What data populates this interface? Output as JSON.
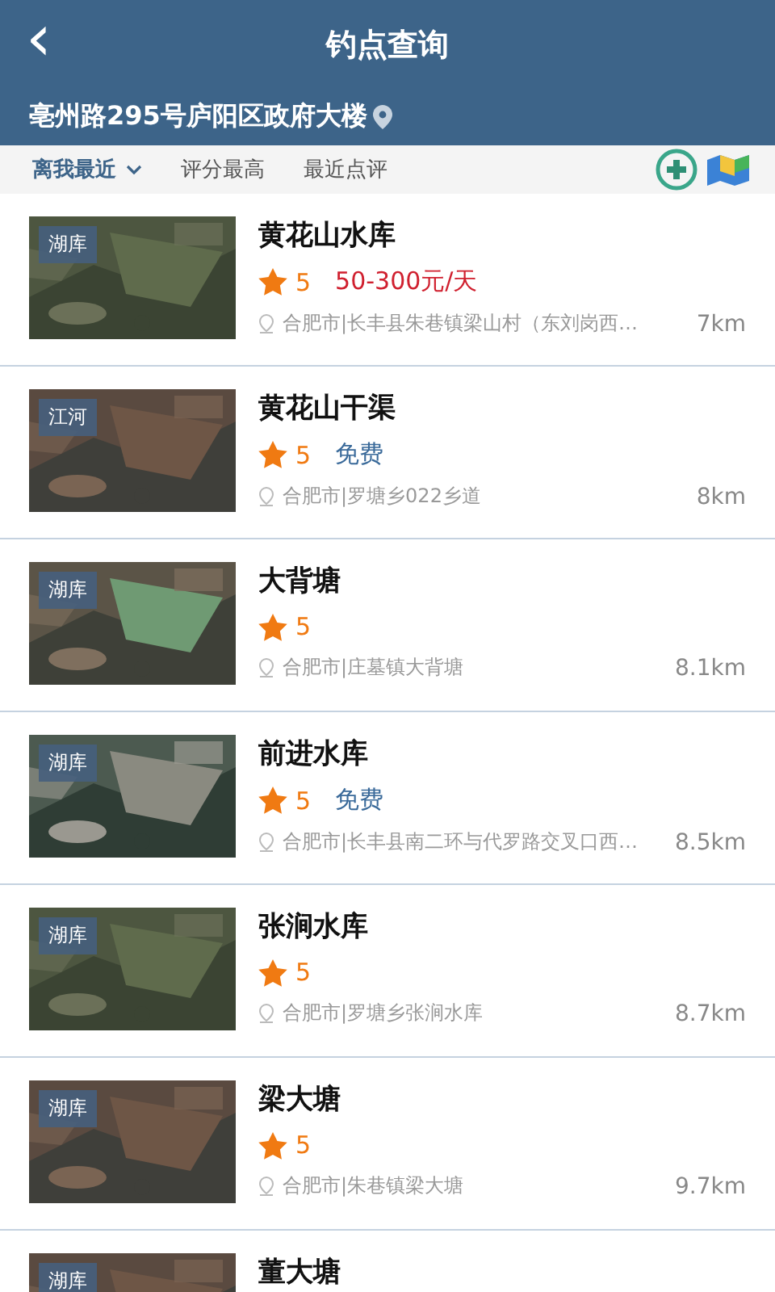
{
  "header": {
    "back": "‹",
    "title": "钓点查询",
    "location": "亳州路295号庐阳区政府大楼"
  },
  "sort_tabs": [
    {
      "label": "离我最近",
      "selected": true,
      "dropdown": true
    },
    {
      "label": "评分最高",
      "selected": false,
      "dropdown": false
    },
    {
      "label": "最近点评",
      "selected": false,
      "dropdown": false
    }
  ],
  "spots": [
    {
      "tag": "湖库",
      "name": "黄花山水库",
      "rating": "5",
      "fee": {
        "kind": "price",
        "text": "50-300元/天"
      },
      "address": "合肥市|长丰县朱巷镇梁山村（东刘岗西…",
      "distance": "7km"
    },
    {
      "tag": "江河",
      "name": "黄花山干渠",
      "rating": "5",
      "fee": {
        "kind": "free",
        "text": "免费"
      },
      "address": "合肥市|罗塘乡022乡道",
      "distance": "8km"
    },
    {
      "tag": "湖库",
      "name": "大背塘",
      "rating": "5",
      "address": "合肥市|庄墓镇大背塘",
      "distance": "8.1km"
    },
    {
      "tag": "湖库",
      "name": "前进水库",
      "rating": "5",
      "fee": {
        "kind": "free",
        "text": "免费"
      },
      "address": "合肥市|长丰县南二环与代罗路交叉口西…",
      "distance": "8.5km"
    },
    {
      "tag": "湖库",
      "name": "张涧水库",
      "rating": "5",
      "address": "合肥市|罗塘乡张涧水库",
      "distance": "8.7km"
    },
    {
      "tag": "湖库",
      "name": "梁大塘",
      "rating": "5",
      "address": "合肥市|朱巷镇梁大塘",
      "distance": "9.7km"
    },
    {
      "tag": "湖库",
      "name": "董大塘"
    }
  ]
}
